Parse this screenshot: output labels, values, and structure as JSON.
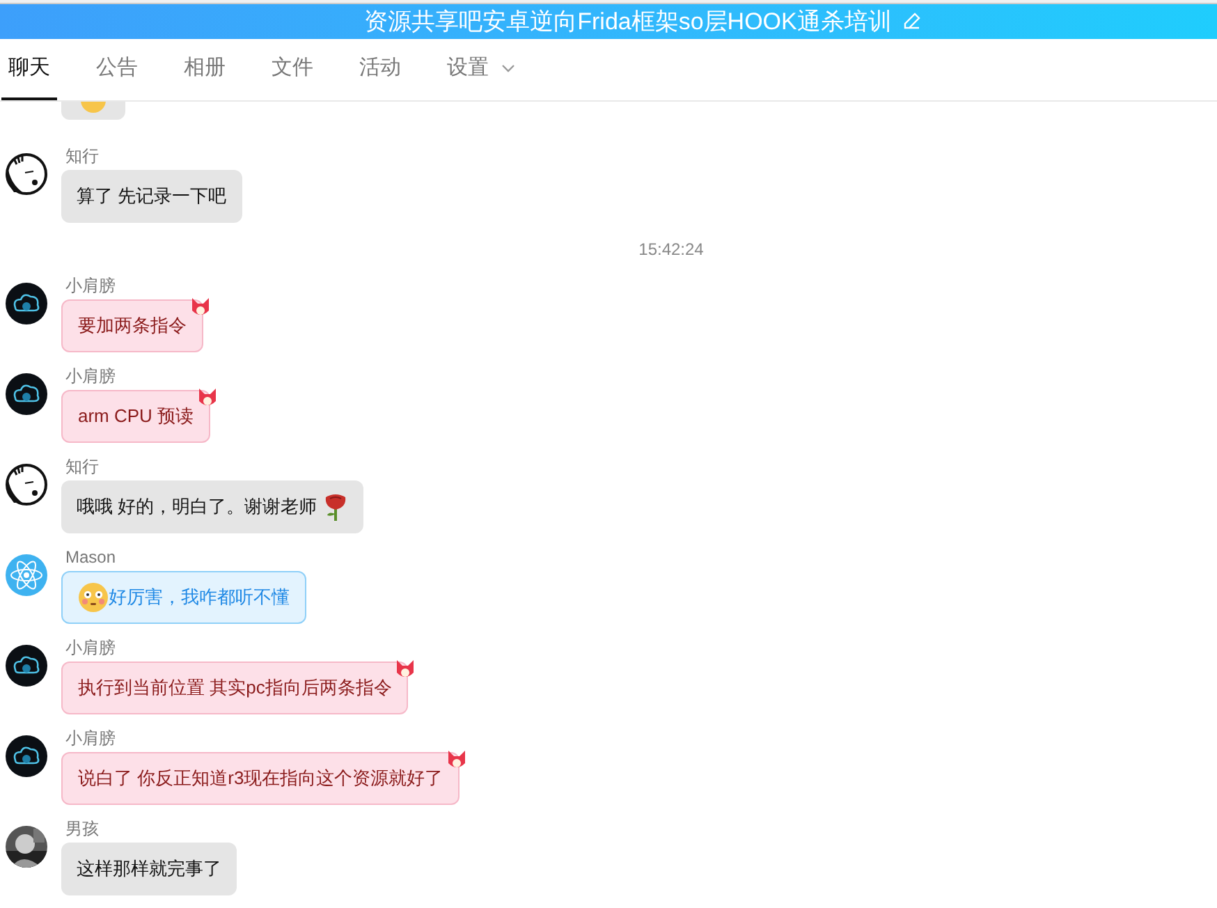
{
  "header": {
    "title": "资源共享吧安卓逆向Frida框架so层HOOK通杀培训"
  },
  "tabs": [
    {
      "label": "聊天",
      "selected": true,
      "dropdown": false
    },
    {
      "label": "公告",
      "selected": false,
      "dropdown": false
    },
    {
      "label": "相册",
      "selected": false,
      "dropdown": false
    },
    {
      "label": "文件",
      "selected": false,
      "dropdown": false
    },
    {
      "label": "活动",
      "selected": false,
      "dropdown": false
    },
    {
      "label": "设置",
      "selected": false,
      "dropdown": true
    }
  ],
  "messages": [
    {
      "kind": "message",
      "sender": "知行",
      "avatar": {
        "kind": "sketch"
      },
      "bubble": {
        "kind": "gray"
      },
      "text": "算了 先记录一下吧",
      "leading_sticker": false,
      "trailing_sticker": false
    },
    {
      "kind": "time",
      "text": "15:42:24"
    },
    {
      "kind": "message",
      "sender": "小肩膀",
      "avatar": {
        "kind": "cloud"
      },
      "bubble": {
        "kind": "pink"
      },
      "text": "要加两条指令",
      "leading_sticker": false,
      "trailing_sticker": false
    },
    {
      "kind": "message",
      "sender": "小肩膀",
      "avatar": {
        "kind": "cloud"
      },
      "bubble": {
        "kind": "pink"
      },
      "text": "arm CPU 预读",
      "leading_sticker": false,
      "trailing_sticker": false
    },
    {
      "kind": "message",
      "sender": "知行",
      "avatar": {
        "kind": "sketch"
      },
      "bubble": {
        "kind": "gray"
      },
      "text": "哦哦 好的，明白了。谢谢老师",
      "leading_sticker": false,
      "trailing_sticker": true
    },
    {
      "kind": "message",
      "sender": "Mason",
      "avatar": {
        "kind": "atom"
      },
      "bubble": {
        "kind": "blue"
      },
      "text": "好厉害，我咋都听不懂",
      "leading_sticker": true,
      "trailing_sticker": false
    },
    {
      "kind": "message",
      "sender": "小肩膀",
      "avatar": {
        "kind": "cloud"
      },
      "bubble": {
        "kind": "pink"
      },
      "text": "执行到当前位置 其实pc指向后两条指令",
      "leading_sticker": false,
      "trailing_sticker": false
    },
    {
      "kind": "message",
      "sender": "小肩膀",
      "avatar": {
        "kind": "cloud"
      },
      "bubble": {
        "kind": "pink"
      },
      "text": "说白了 你反正知道r3现在指向这个资源就好了",
      "leading_sticker": false,
      "trailing_sticker": false
    },
    {
      "kind": "message",
      "sender": "男孩",
      "bubble": {
        "kind": "gray"
      },
      "text": "这样那样就完事了",
      "leading_sticker": false,
      "trailing_sticker": false
    }
  ]
}
